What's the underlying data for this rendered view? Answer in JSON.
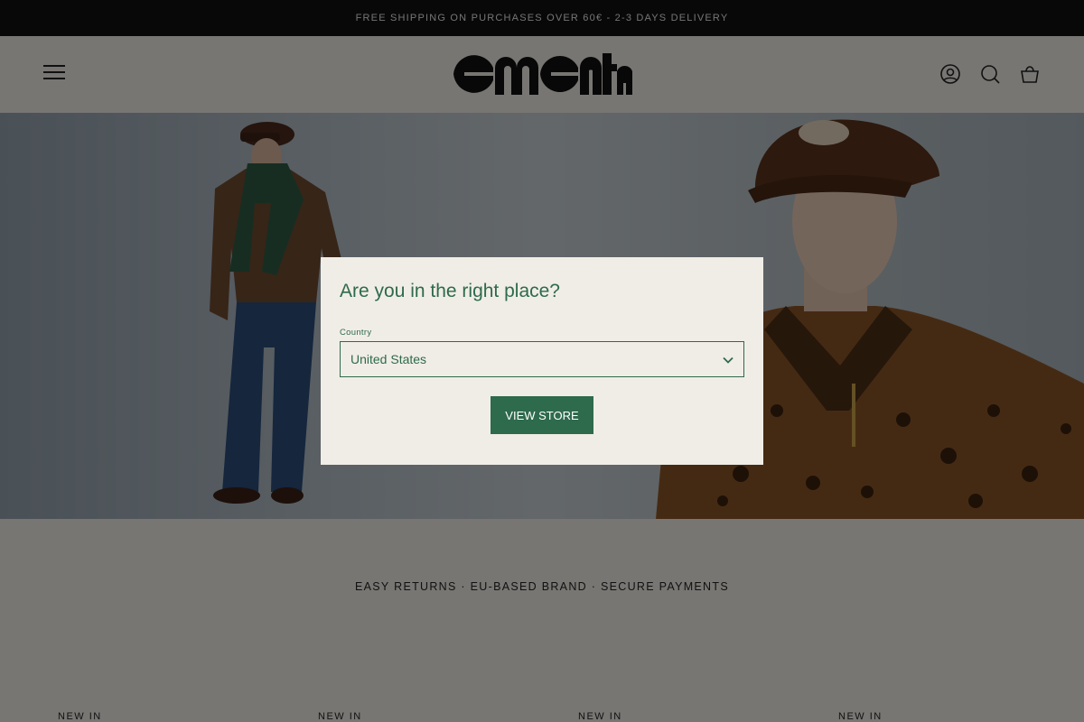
{
  "announcement": "FREE SHIPPING ON PURCHASES OVER 60€ - 2-3 DAYS DELIVERY",
  "header": {
    "icons": [
      "menu-icon",
      "account-icon",
      "search-icon",
      "cart-icon"
    ]
  },
  "trust_bar": "EASY RETURNS · EU-BASED BRAND · SECURE PAYMENTS",
  "product_labels": [
    "NEW IN",
    "NEW IN",
    "NEW IN",
    "NEW IN"
  ],
  "modal": {
    "title": "Are you in the right place?",
    "country_label": "Country",
    "country_value": "United States",
    "button": "VIEW STORE"
  },
  "colors": {
    "accent": "#2e6a4c",
    "background": "#f0ede6",
    "announcement_bg": "#111111"
  }
}
